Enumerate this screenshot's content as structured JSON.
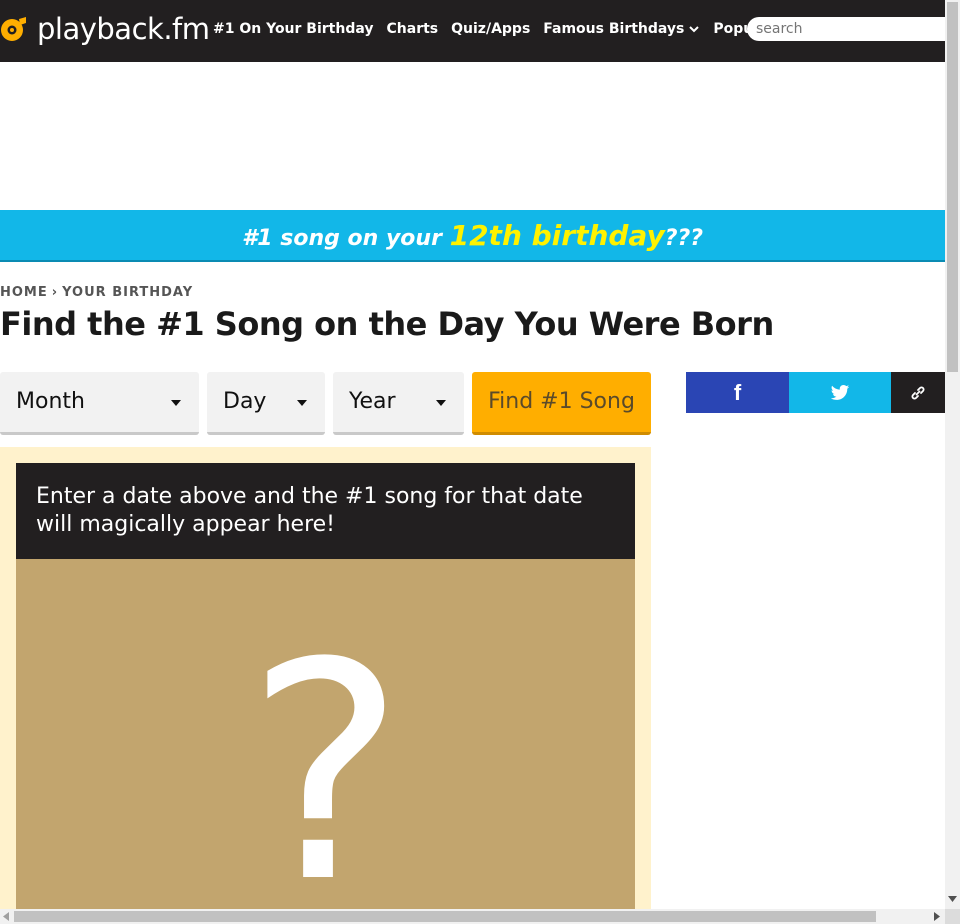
{
  "nav": {
    "brand": "playback.fm",
    "links": [
      "#1 On Your Birthday",
      "Charts",
      "Quiz/Apps"
    ],
    "dropdowns": [
      "Famous Birthdays",
      "Popular"
    ],
    "search_placeholder": "search"
  },
  "banner": {
    "prefix": "#1 song on your ",
    "highlight": "12th birthday",
    "suffix": "???"
  },
  "breadcrumb": {
    "home": "HOME",
    "separator": "›",
    "current": "YOUR BIRTHDAY"
  },
  "page_title": "Find the #1 Song on the Day You Were Born",
  "form": {
    "month_label": "Month",
    "day_label": "Day",
    "year_label": "Year",
    "submit_label": "Find #1 Song"
  },
  "share": {
    "facebook": "f",
    "twitter": "twitter-icon",
    "link": "link-icon"
  },
  "result": {
    "message": "Enter a date above and the #1 song for that date will magically appear here!",
    "placeholder": "?"
  },
  "colors": {
    "nav_bg": "#221f20",
    "banner_bg": "#12b7e8",
    "banner_highlight": "#fff200",
    "button_bg": "#ffae00",
    "panel_bg": "#fff2cc",
    "art_bg": "#c2a56e",
    "facebook": "#2a45b4",
    "twitter": "#12b7e8"
  }
}
